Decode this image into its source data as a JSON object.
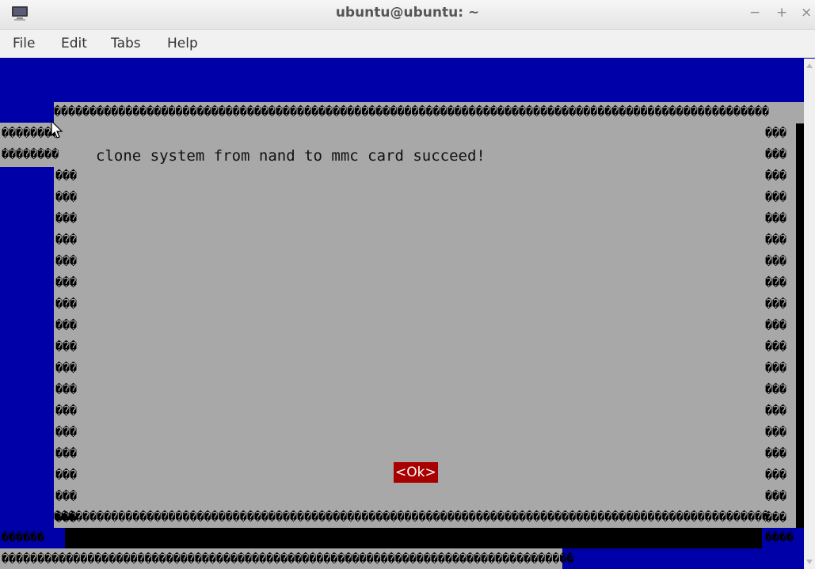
{
  "window": {
    "title": "ubuntu@ubuntu: ~",
    "controls": {
      "minimize": "−",
      "maximize": "+",
      "close": "×"
    }
  },
  "menubar": {
    "items": [
      "File",
      "Edit",
      "Tabs",
      "Help"
    ]
  },
  "dialog": {
    "message": "clone system from nand to mmc card succeed!",
    "ok_label": "<Ok>"
  },
  "garbled_glyph": "�",
  "colors": {
    "background": "#0000a8",
    "dialog": "#a8a8a8",
    "button": "#a80000",
    "shadow": "#000000"
  }
}
